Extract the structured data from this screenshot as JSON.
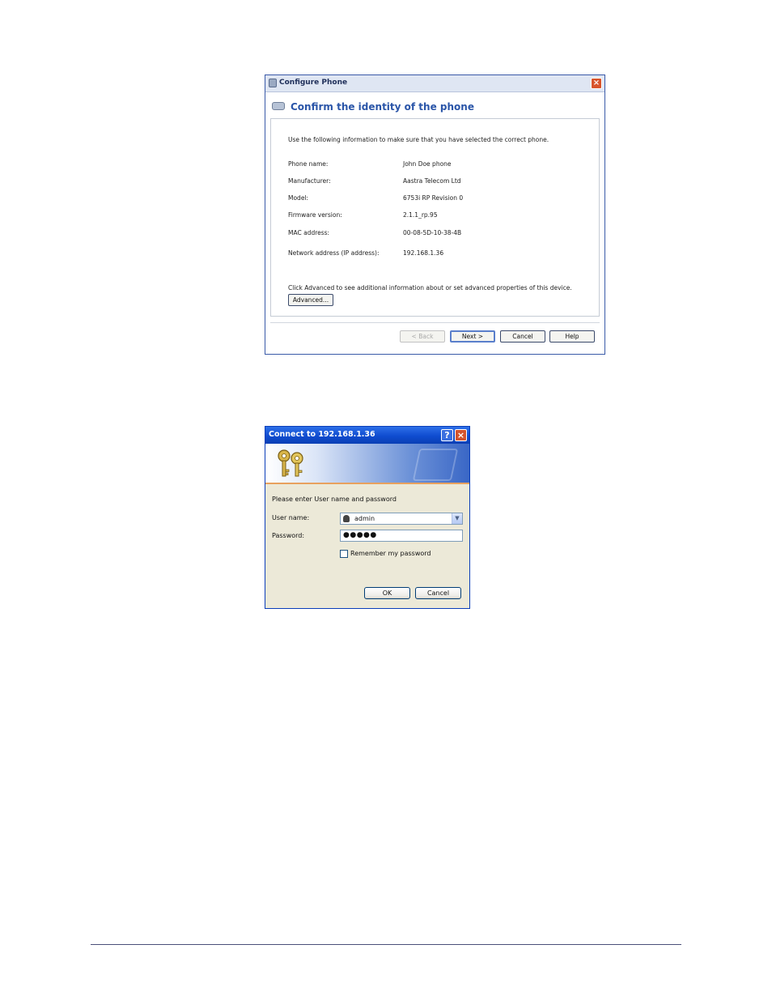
{
  "configure_dialog": {
    "window_title": "Configure Phone",
    "close_glyph": "×",
    "heading": "Confirm the identity of the phone",
    "intro": "Use the following information to make sure that you have selected the correct phone.",
    "fields": [
      {
        "label": "Phone name:",
        "value": "John Doe phone"
      },
      {
        "label": "Manufacturer:",
        "value": "Aastra Telecom Ltd"
      },
      {
        "label": "Model:",
        "value": "6753i RP Revision 0"
      },
      {
        "label": "Firmware version:",
        "value": "2.1.1_rp.95"
      },
      {
        "label": "MAC address:",
        "value": "00-08-5D-10-38-4B"
      },
      {
        "label": "Network address (IP address):",
        "value": "192.168.1.36"
      }
    ],
    "advanced_note": "Click Advanced to see additional information about or set advanced properties of this device.",
    "buttons": {
      "advanced": "Advanced...",
      "back": "< Back",
      "next": "Next >",
      "cancel": "Cancel",
      "help": "Help"
    }
  },
  "login_dialog": {
    "window_title": "Connect to 192.168.1.36",
    "help_glyph": "?",
    "close_glyph": "×",
    "prompt": "Please enter User name and password",
    "username_label": "User name:",
    "username_value": "admin",
    "password_label": "Password:",
    "password_value": "●●●●●",
    "remember_label": "Remember my password",
    "remember_checked": false,
    "ok_label": "OK",
    "cancel_label": "Cancel",
    "dropdown_glyph": "▼"
  }
}
